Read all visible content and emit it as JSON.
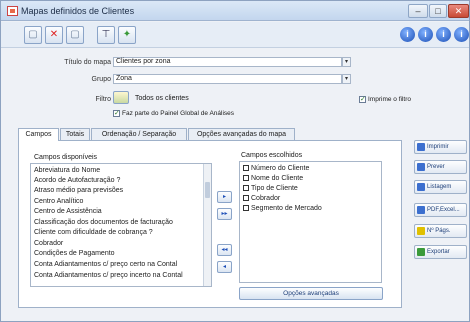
{
  "window": {
    "title": "Mapas definidos de Clientes",
    "minimize": "–",
    "maximize": "□",
    "close": "✕"
  },
  "toolbar": {
    "new": "▢",
    "delete": "✕",
    "copy": "▢",
    "edit": "⊤",
    "export": "✦",
    "info": [
      "i",
      "i",
      "i",
      "i"
    ]
  },
  "form": {
    "titulo_label": "Título do mapa",
    "titulo_value": "Clientes por zona",
    "grupo_label": "Grupo",
    "grupo_value": "Zona",
    "filtro_label": "Filtro",
    "filtro_value": "Todos os clientes",
    "painel_label": "Faz parte do Painel Global de Análises",
    "imprime_filtro_label": "Imprime o filtro",
    "dropdown_arrow": "▾"
  },
  "tabs": [
    "Campos",
    "Totais",
    "Ordenação / Separação",
    "Opções avançadas do mapa"
  ],
  "campos": {
    "disponiveis_label": "Campos disponíveis",
    "disponiveis": [
      "Abreviatura do Nome",
      "Acordo de Autofacturação ?",
      "Atraso médio para previsões",
      "Centro Analítico",
      "Centro de Assistência",
      "Classificação dos documentos de facturação",
      "Cliente com dificuldade de cobrança ?",
      "Cobrador",
      "Condições de Pagamento",
      "Conta Adiantamentos c/ preço certo na Contal",
      "Conta Adiantamentos c/ preço incerto na Contal"
    ],
    "escolhidos_label": "Campos escolhidos",
    "escolhidos": [
      "Número do Cliente",
      "Nome do Cliente",
      "Tipo de Cliente",
      "Cobrador",
      "Segmento de Mercado"
    ],
    "opcoes_button": "Opções avançadas",
    "move_buttons": [
      "▸",
      "▸▸",
      "◂◂",
      "◂"
    ]
  },
  "side_buttons": [
    "Imprimir",
    "Prever",
    "Listagem",
    "PDF,Excel...",
    "Nº Págs.",
    "Exportar"
  ]
}
